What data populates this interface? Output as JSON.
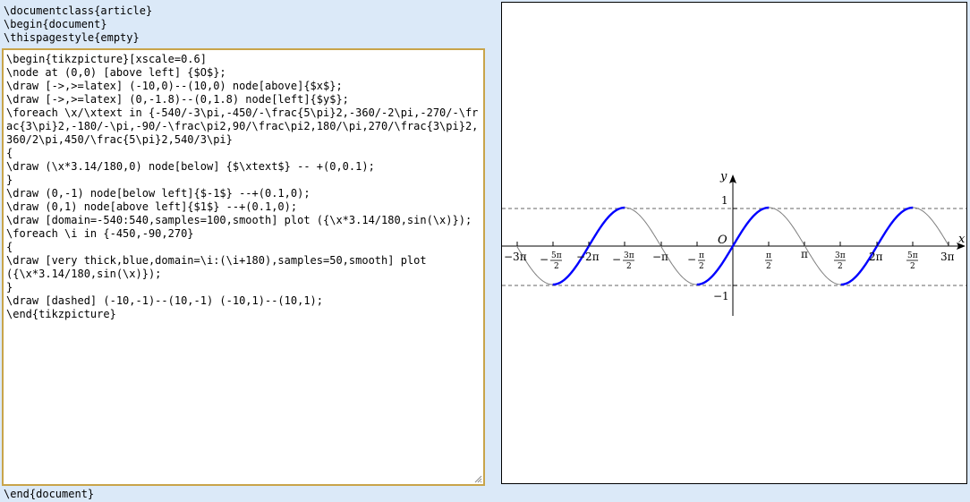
{
  "editor": {
    "preamble": "\\documentclass{article}\n\\begin{document}\n\\thispagestyle{empty}",
    "code": "\\begin{tikzpicture}[xscale=0.6]\n\\node at (0,0) [above left] {$O$};\n\\draw [->,>=latex] (-10,0)--(10,0) node[above]{$x$};\n\\draw [->,>=latex] (0,-1.8)--(0,1.8) node[left]{$y$};\n\\foreach \\x/\\xtext in {-540/-3\\pi,-450/-\\frac{5\\pi}2,-360/-2\\pi,-270/-\\frac{3\\pi}2,-180/-\\pi,-90/-\\frac\\pi2,90/\\frac\\pi2,180/\\pi,270/\\frac{3\\pi}2,360/2\\pi,450/\\frac{5\\pi}2,540/3\\pi}\n{\n\\draw (\\x*3.14/180,0) node[below] {$\\xtext$} -- +(0,0.1);\n}\n\\draw (0,-1) node[below left]{$-1$} --+(0.1,0);\n\\draw (0,1) node[above left]{$1$} --+(0.1,0);\n\\draw [domain=-540:540,samples=100,smooth] plot ({\\x*3.14/180,sin(\\x)});\n\\foreach \\i in {-450,-90,270}\n{\n\\draw [very thick,blue,domain=\\i:(\\i+180),samples=50,smooth] plot\n({\\x*3.14/180,sin(\\x)});\n}\n\\draw [dashed] (-10,-1)--(10,-1) (-10,1)--(10,1);\n\\end{tikzpicture}",
    "postamble": "\\end{document}"
  },
  "preview": {
    "labels": {
      "x": "x",
      "y": "y",
      "origin": "O",
      "one": "1",
      "minus_one": "−1",
      "pi": "π",
      "neg_pi": "−π",
      "two_pi": "2π",
      "neg_two_pi": "−2π",
      "three_pi": "3π",
      "neg_three_pi": "−3π",
      "half_pi_num": "π",
      "three_pi_num": "3π",
      "five_pi_num": "5π",
      "den": "2",
      "minus": "−"
    },
    "colors": {
      "curve": "#808080",
      "highlight": "#0000ff",
      "axis": "#000000",
      "dashed": "#666666"
    }
  }
}
